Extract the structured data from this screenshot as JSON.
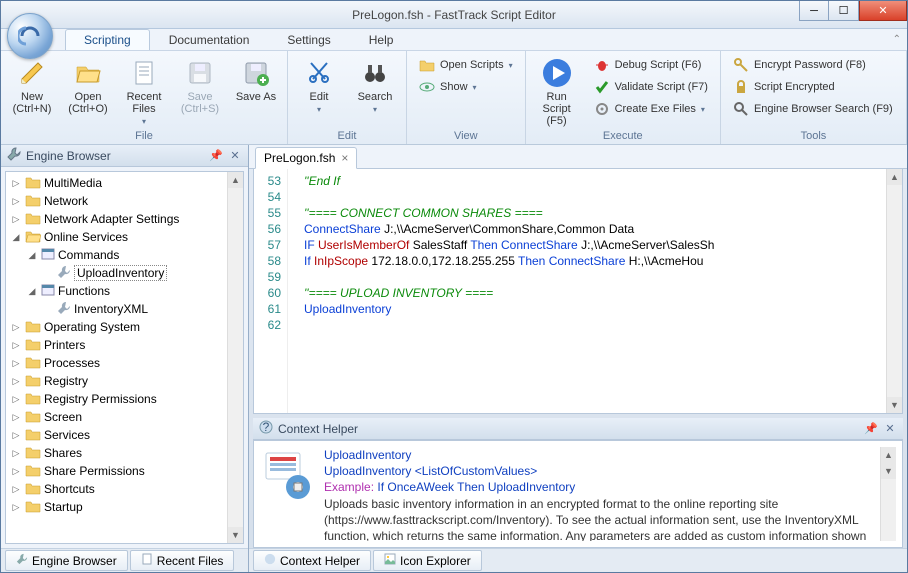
{
  "window": {
    "title": "PreLogon.fsh - FastTrack Script Editor"
  },
  "ribbon_tabs": [
    "Scripting",
    "Documentation",
    "Settings",
    "Help"
  ],
  "ribbon_active": 0,
  "ribbon": {
    "file": {
      "label": "File",
      "new": "New\n(Ctrl+N)",
      "open": "Open\n(Ctrl+O)",
      "recent": "Recent\nFiles",
      "save": "Save\n(Ctrl+S)",
      "saveas": "Save As"
    },
    "edit": {
      "label": "Edit",
      "edit": "Edit",
      "search": "Search"
    },
    "view": {
      "label": "View",
      "openscripts": "Open Scripts",
      "show": "Show"
    },
    "execute": {
      "label": "Execute",
      "run": "Run Script\n(F5)",
      "debug": "Debug Script (F6)",
      "validate": "Validate Script (F7)",
      "createexe": "Create Exe Files"
    },
    "tools": {
      "label": "Tools",
      "encrypt": "Encrypt Password (F8)",
      "scripted": "Script Encrypted",
      "browser": "Engine Browser Search (F9)"
    }
  },
  "engine_browser": {
    "title": "Engine Browser",
    "nodes": {
      "multimedia": "MultiMedia",
      "network": "Network",
      "netadapter": "Network Adapter Settings",
      "online": "Online Services",
      "commands": "Commands",
      "uploadinv": "UploadInventory",
      "functions": "Functions",
      "invxml": "InventoryXML",
      "os": "Operating System",
      "printers": "Printers",
      "processes": "Processes",
      "registry": "Registry",
      "regperm": "Registry Permissions",
      "screen": "Screen",
      "services": "Services",
      "shares": "Shares",
      "shareperm": "Share Permissions",
      "shortcuts": "Shortcuts",
      "startup": "Startup"
    }
  },
  "sidebar_tabs": {
    "engine": "Engine Browser",
    "recent": "Recent Files"
  },
  "editor": {
    "tab": "PreLogon.fsh",
    "lines_start": 53,
    "lines": [
      {
        "segments": [
          {
            "t": "''End If",
            "c": "green"
          }
        ]
      },
      {
        "segments": []
      },
      {
        "segments": [
          {
            "t": "''==== CONNECT COMMON SHARES ====",
            "c": "green"
          }
        ]
      },
      {
        "segments": [
          {
            "t": "ConnectShare ",
            "c": "blue"
          },
          {
            "t": "J:,\\\\AcmeServer\\CommonShare,Common Data",
            "c": "black"
          }
        ]
      },
      {
        "segments": [
          {
            "t": "IF ",
            "c": "blue"
          },
          {
            "t": "UserIsMemberOf ",
            "c": "red"
          },
          {
            "t": "SalesStaff ",
            "c": "black"
          },
          {
            "t": "Then ",
            "c": "blue"
          },
          {
            "t": "ConnectShare ",
            "c": "blue"
          },
          {
            "t": "J:,\\\\AcmeServer\\SalesSh",
            "c": "black"
          }
        ]
      },
      {
        "segments": [
          {
            "t": "If ",
            "c": "blue"
          },
          {
            "t": "InIpScope ",
            "c": "red"
          },
          {
            "t": "172.18.0.0,172.18.255.255 ",
            "c": "black"
          },
          {
            "t": "Then ",
            "c": "blue"
          },
          {
            "t": "ConnectShare ",
            "c": "blue"
          },
          {
            "t": "H:,\\\\AcmeHou",
            "c": "black"
          }
        ]
      },
      {
        "segments": []
      },
      {
        "segments": [
          {
            "t": "''==== UPLOAD INVENTORY ====",
            "c": "green"
          }
        ]
      },
      {
        "segments": [
          {
            "t": "UploadInventory",
            "c": "blue"
          }
        ]
      },
      {
        "segments": []
      }
    ]
  },
  "context_helper": {
    "title": "Context Helper",
    "line1": "UploadInventory",
    "line2": "UploadInventory <ListOfCustomValues>",
    "example_label": "Example: ",
    "example": "If OnceAWeek Then UploadInventory",
    "desc": "Uploads basic inventory information in an encrypted format to the online reporting site (https://www.fasttrackscript.com/Inventory). To see the actual information sent, use the InventoryXML function, which returns the same information. Any parameters are added as custom information shown on"
  },
  "bottom_tabs": {
    "context": "Context Helper",
    "iconexp": "Icon Explorer"
  }
}
